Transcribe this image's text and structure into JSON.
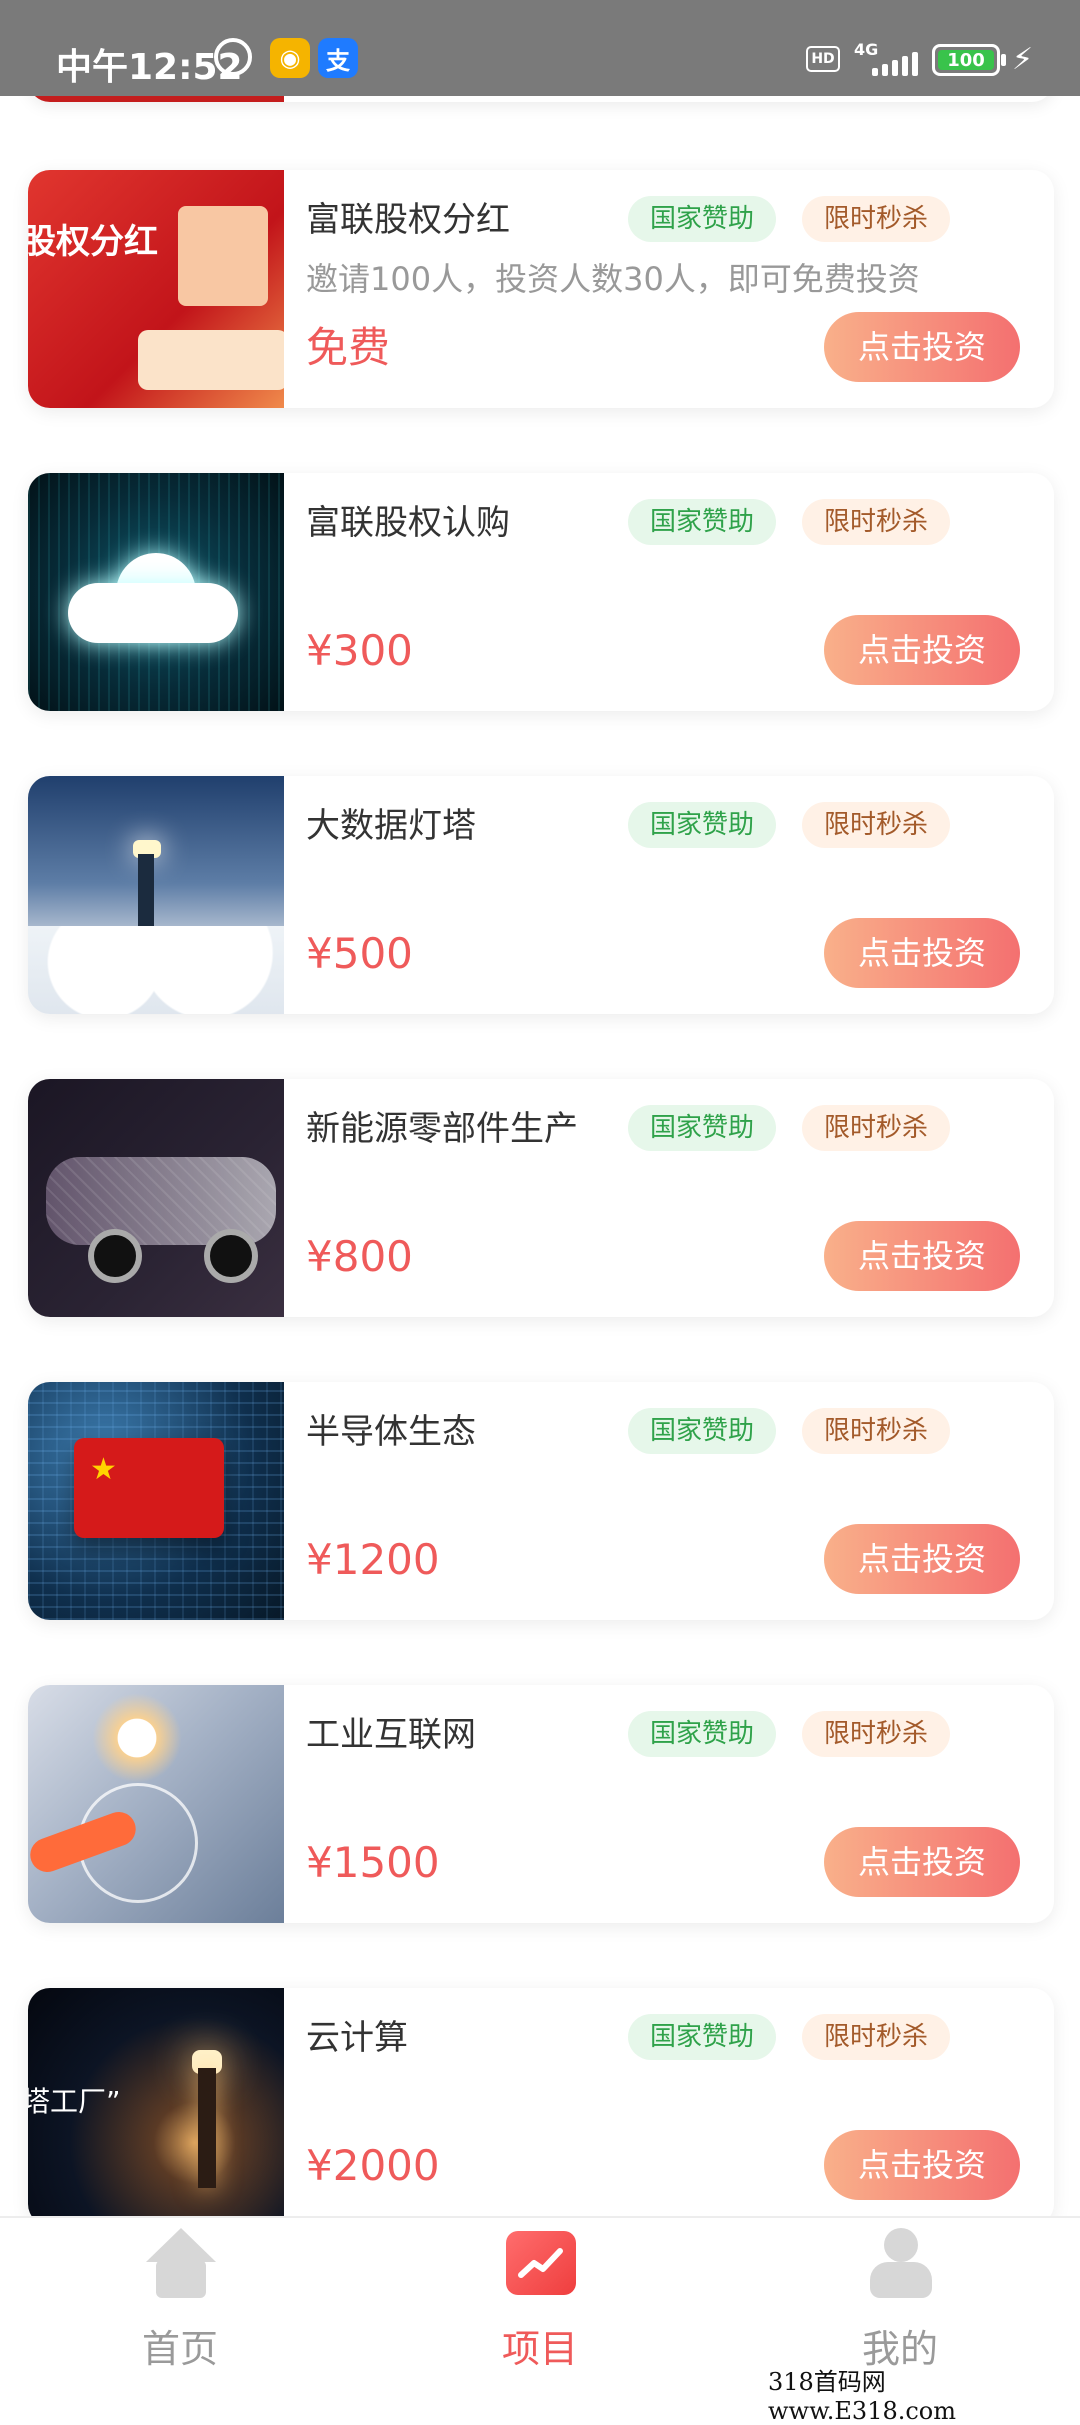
{
  "status_bar": {
    "time": "中午12:52",
    "network": "4G",
    "hd": "HD",
    "battery": "100",
    "charging": "⚡"
  },
  "products": [
    {
      "title": "富联股权分红",
      "tags": [
        "国家赞助",
        "限时秒杀"
      ],
      "desc": "邀请100人，投资人数30人，即可免费投资",
      "price": "免费",
      "button": "点击投资",
      "image_text": "股权分红"
    },
    {
      "title": "富联股权认购",
      "tags": [
        "国家赞助",
        "限时秒杀"
      ],
      "price": "¥300",
      "button": "点击投资"
    },
    {
      "title": "大数据灯塔",
      "tags": [
        "国家赞助",
        "限时秒杀"
      ],
      "price": "¥500",
      "button": "点击投资"
    },
    {
      "title": "新能源零部件生产",
      "tags": [
        "国家赞助",
        "限时秒杀"
      ],
      "price": "¥800",
      "button": "点击投资"
    },
    {
      "title": "半导体生态",
      "tags": [
        "国家赞助",
        "限时秒杀"
      ],
      "price": "¥1200",
      "button": "点击投资"
    },
    {
      "title": "工业互联网",
      "tags": [
        "国家赞助",
        "限时秒杀"
      ],
      "price": "¥1500",
      "button": "点击投资"
    },
    {
      "title": "云计算",
      "tags": [
        "国家赞助",
        "限时秒杀"
      ],
      "price": "¥2000",
      "button": "点击投资",
      "image_text": "塔工厂”"
    }
  ],
  "bottom_nav": {
    "items": [
      {
        "label": "首页",
        "icon": "home-icon"
      },
      {
        "label": "项目",
        "icon": "project-icon"
      },
      {
        "label": "我的",
        "icon": "user-icon"
      }
    ],
    "active": "项目"
  },
  "watermark": "318首码网 www.E318.com",
  "colors": {
    "accent": "#ef5a5a",
    "tag_green_bg": "#e6f7ea",
    "tag_green_text": "#2fa24a",
    "tag_orange_bg": "#fff1e6",
    "tag_orange_text": "#a35a2a",
    "button_gradient_start": "#f9b08a",
    "button_gradient_end": "#f47070"
  }
}
